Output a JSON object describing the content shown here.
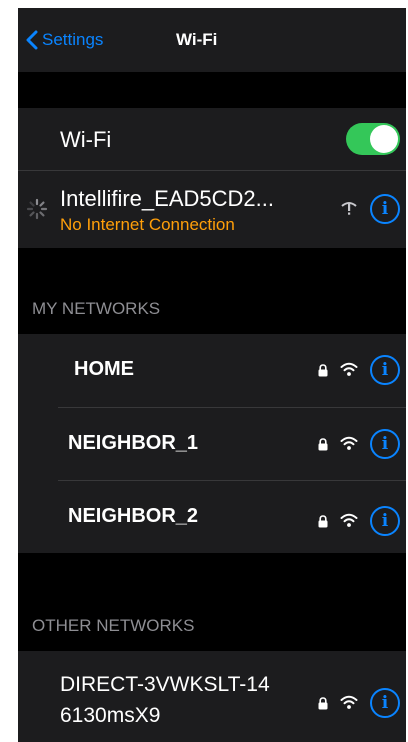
{
  "navbar": {
    "back_label": "Settings",
    "title": "Wi-Fi"
  },
  "wifi": {
    "label": "Wi-Fi",
    "enabled": true,
    "toggle_color": "#34c759"
  },
  "current_network": {
    "name": "Intellifire_EAD5CD2...",
    "status": "No Internet Connection",
    "status_color": "#ff9f0a"
  },
  "my_networks": {
    "header": "MY NETWORKS",
    "items": [
      {
        "name": "HOME",
        "secured": true
      },
      {
        "name": "NEIGHBOR_1",
        "secured": true
      },
      {
        "name": "NEIGHBOR_2",
        "secured": true
      }
    ]
  },
  "other_networks": {
    "header": "OTHER NETWORKS",
    "items": [
      {
        "name_line1": "DIRECT-3VWKSLT-14",
        "name_line2": "6130msX9",
        "secured": true
      }
    ]
  },
  "icons": {
    "back": "chevron-left-icon",
    "info": "info-icon",
    "lock": "lock-icon",
    "wifi": "wifi-icon",
    "loading": "spinner-icon",
    "no_internet": "wifi-exclamation-icon"
  },
  "accent_color": "#0a84ff"
}
